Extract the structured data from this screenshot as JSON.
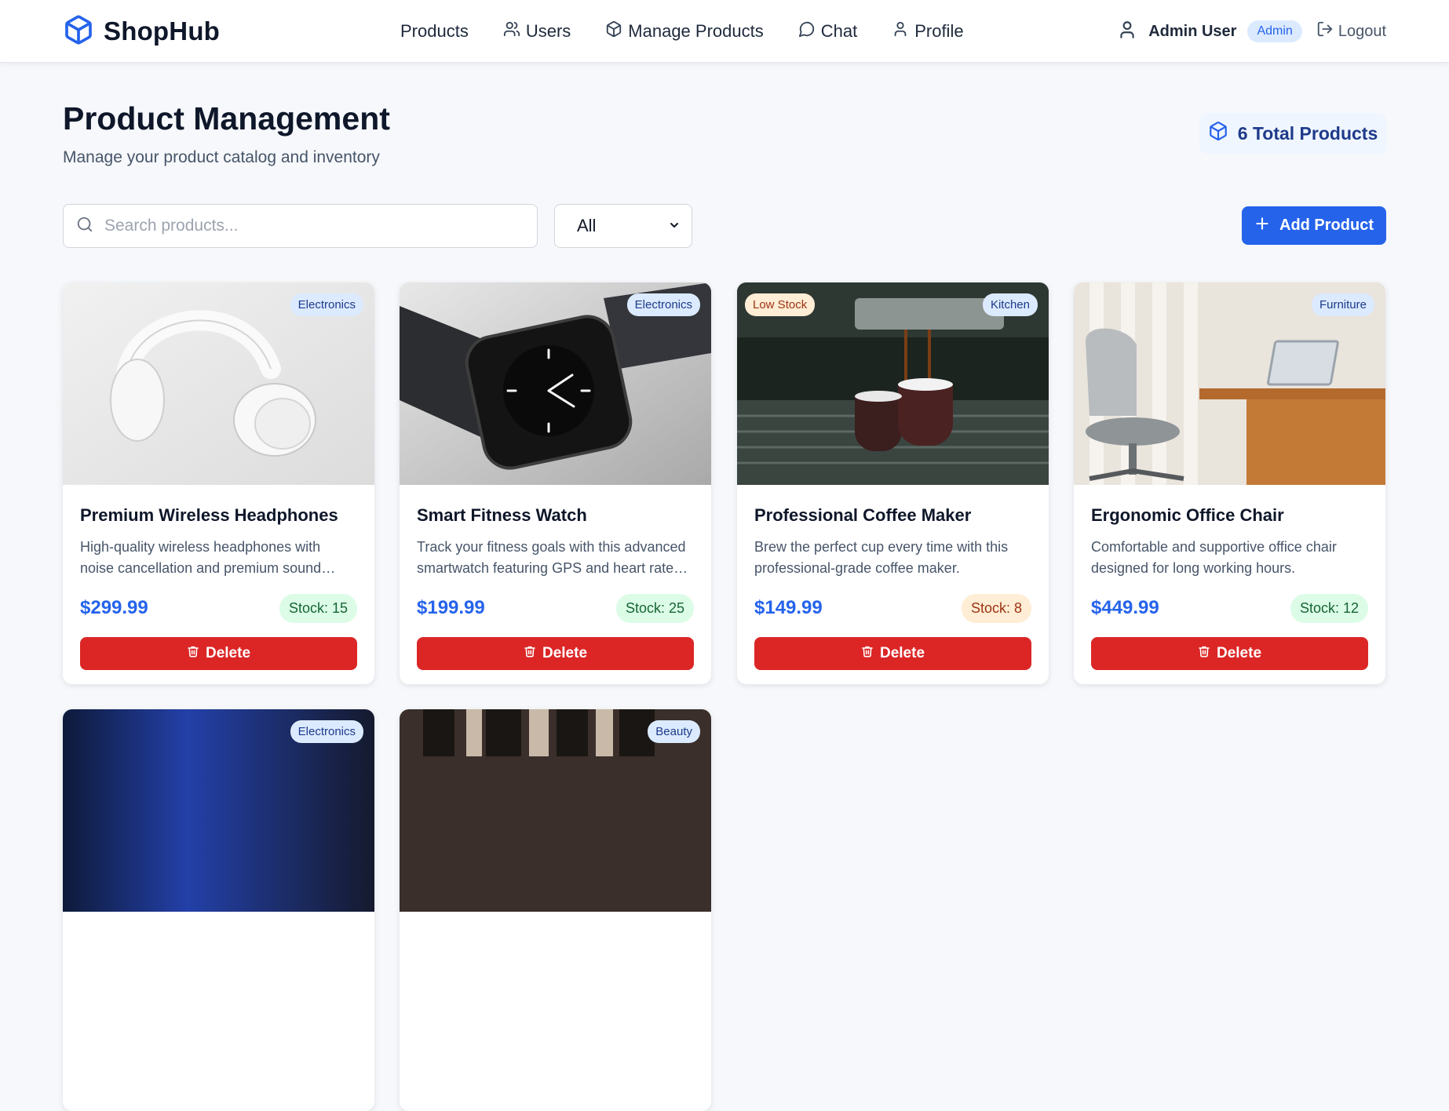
{
  "app": {
    "name": "ShopHub"
  },
  "nav": {
    "links": [
      {
        "label": "Products",
        "icon": ""
      },
      {
        "label": "Users",
        "icon": "users-icon"
      },
      {
        "label": "Manage Products",
        "icon": "box-icon"
      },
      {
        "label": "Chat",
        "icon": "chat-icon"
      },
      {
        "label": "Profile",
        "icon": "user-icon"
      }
    ],
    "user": {
      "name": "Admin User",
      "role": "Admin"
    },
    "logout": "Logout"
  },
  "header": {
    "title": "Product Management",
    "subtitle": "Manage your product catalog and inventory",
    "total_label": "6 Total Products"
  },
  "toolbar": {
    "search_placeholder": "Search products...",
    "search_value": "",
    "filter_selected": "All",
    "add_label": "Add Product"
  },
  "colors": {
    "primary": "#2563eb",
    "danger": "#dc2626",
    "stock_ok_bg": "#dcfce7",
    "stock_low_bg": "#ffedd5",
    "category_bg": "#dbeafe"
  },
  "products": [
    {
      "title": "Premium Wireless Headphones",
      "description": "High-quality wireless headphones with noise cancellation and premium sound quality.",
      "price": "$299.99",
      "stock": "Stock: 15",
      "category": "Electronics",
      "low_stock": "",
      "delete": "Delete"
    },
    {
      "title": "Smart Fitness Watch",
      "description": "Track your fitness goals with this advanced smartwatch featuring GPS and heart rate monitoring.",
      "price": "$199.99",
      "stock": "Stock: 25",
      "category": "Electronics",
      "low_stock": "",
      "delete": "Delete"
    },
    {
      "title": "Professional Coffee Maker",
      "description": "Brew the perfect cup every time with this professional-grade coffee maker.",
      "price": "$149.99",
      "stock": "Stock: 8",
      "category": "Kitchen",
      "low_stock": "Low Stock",
      "delete": "Delete"
    },
    {
      "title": "Ergonomic Office Chair",
      "description": "Comfortable and supportive office chair designed for long working hours.",
      "price": "$449.99",
      "stock": "Stock: 12",
      "category": "Furniture",
      "low_stock": "",
      "delete": "Delete"
    },
    {
      "category": "Electronics"
    },
    {
      "category": "Beauty"
    }
  ]
}
